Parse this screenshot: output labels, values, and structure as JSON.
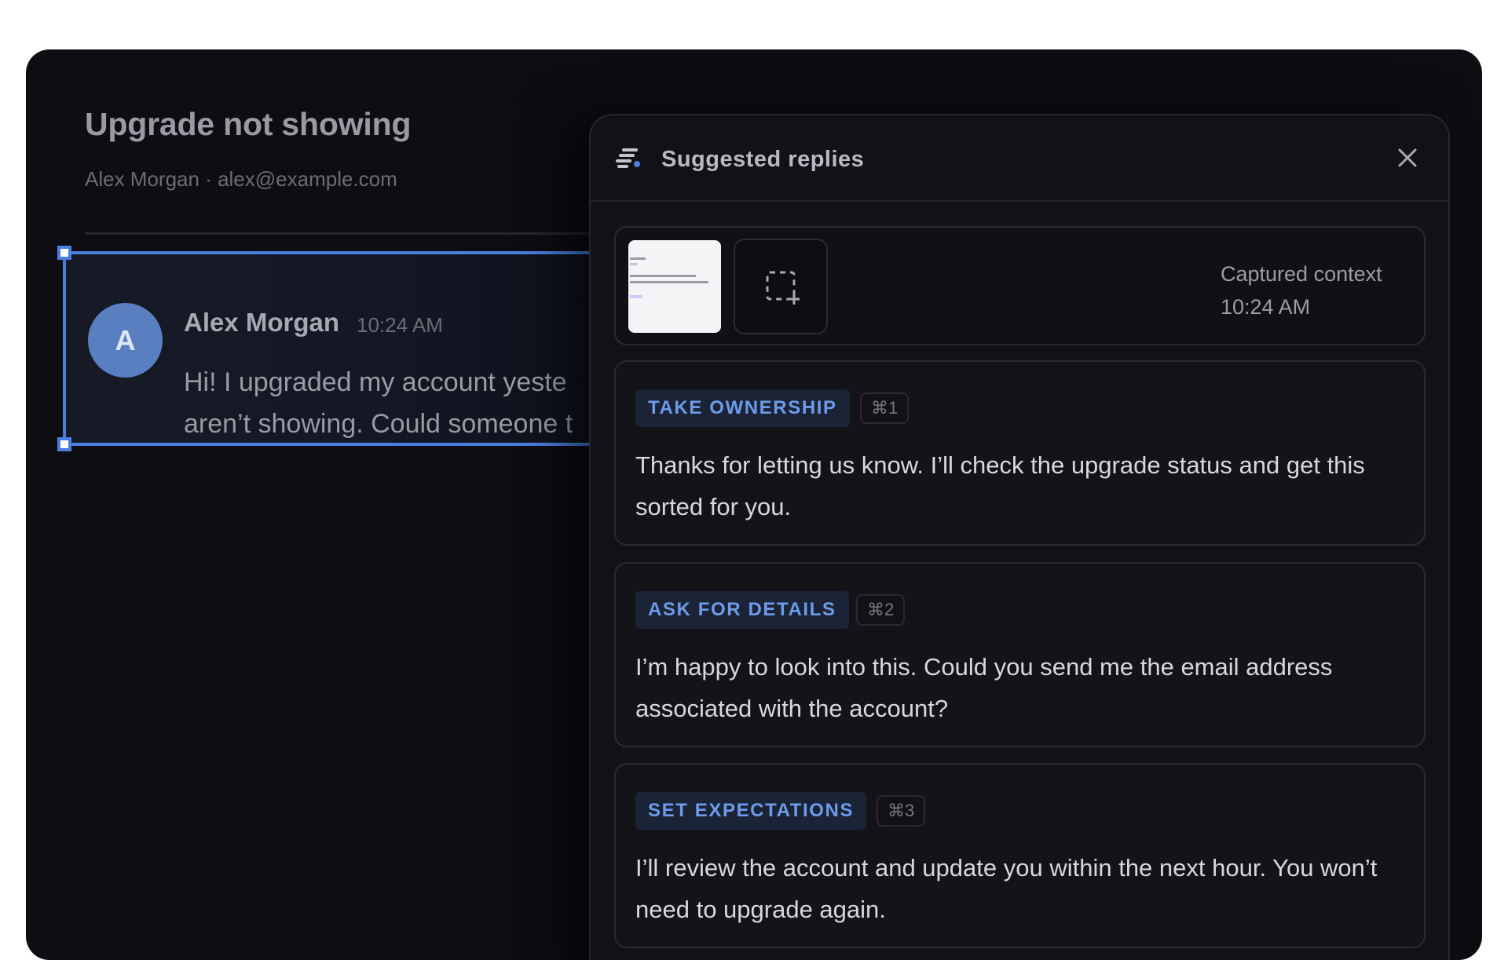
{
  "ticket": {
    "title": "Upgrade not showing",
    "meta": "Alex Morgan · alex@example.com"
  },
  "message": {
    "avatar_initial": "A",
    "author": "Alex Morgan",
    "time": "10:24 AM",
    "body_line1": "Hi! I upgraded my account yeste",
    "body_line2": "aren’t showing. Could someone t"
  },
  "panel": {
    "title": "Suggested replies",
    "icon": "sparkle-lines-icon",
    "close_icon": "close-icon",
    "context": {
      "label": "Captured context",
      "time": "10:24 AM",
      "capture_icon": "capture-region-icon"
    },
    "replies": [
      {
        "tag": "TAKE OWNERSHIP",
        "shortcut": "⌘1",
        "text": "Thanks for letting us know. I’ll check the upgrade status and get this sorted for you."
      },
      {
        "tag": "ASK FOR DETAILS",
        "shortcut": "⌘2",
        "text": "I’m happy to look into this. Could you send me the email address associated with the account?"
      },
      {
        "tag": "SET EXPECTATIONS",
        "shortcut": "⌘3",
        "text": "I’ll review the account and update you within the next hour. You won’t need to upgrade again."
      }
    ]
  },
  "colors": {
    "accent": "#4a7ee0",
    "tag_text": "#6d9be9",
    "window_bg": "#0d0d12"
  }
}
